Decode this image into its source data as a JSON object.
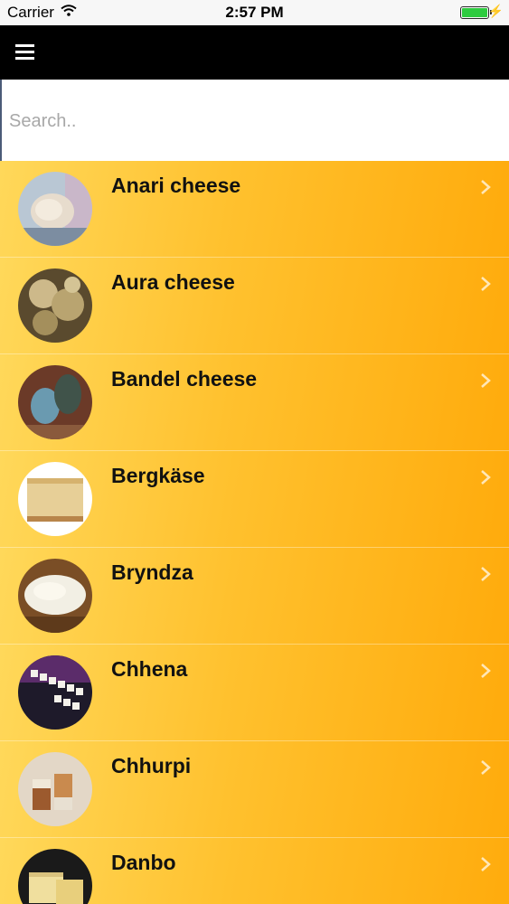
{
  "status_bar": {
    "carrier": "Carrier",
    "time": "2:57 PM"
  },
  "nav": {
    "menu_icon": "hamburger-menu-icon"
  },
  "search": {
    "placeholder": "Search..",
    "value": ""
  },
  "items": [
    {
      "name": "Anari cheese"
    },
    {
      "name": "Aura cheese"
    },
    {
      "name": "Bandel cheese"
    },
    {
      "name": "Bergkäse"
    },
    {
      "name": "Bryndza"
    },
    {
      "name": "Chhena"
    },
    {
      "name": "Chhurpi"
    },
    {
      "name": "Danbo"
    }
  ]
}
